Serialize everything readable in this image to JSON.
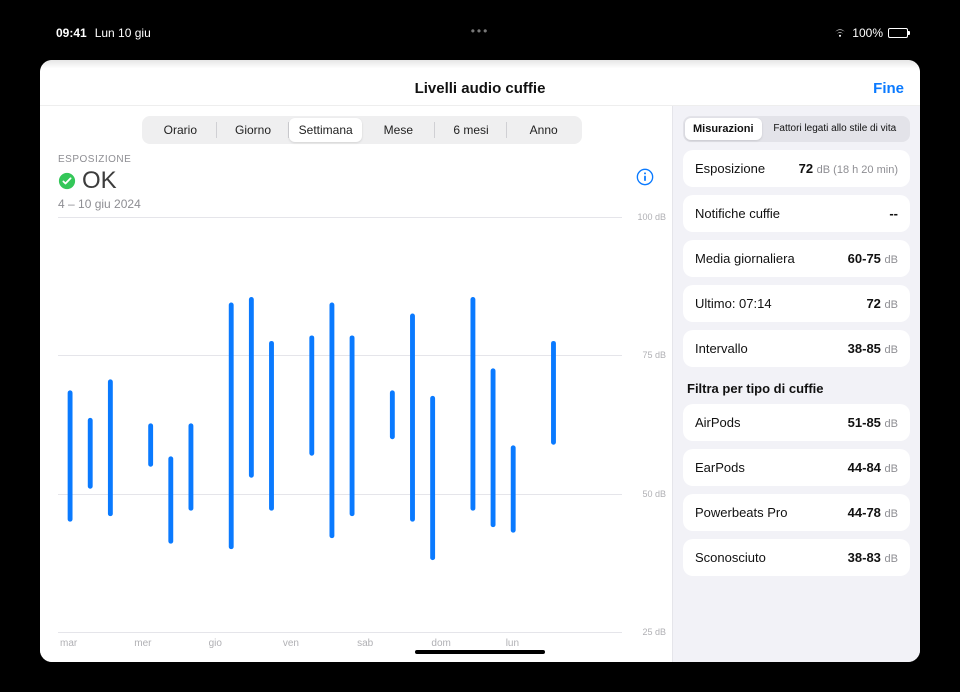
{
  "status_bar": {
    "time": "09:41",
    "date": "Lun 10 giu",
    "battery_pct": "100%"
  },
  "sheet": {
    "title": "Livelli audio cuffie",
    "done": "Fine"
  },
  "segments": [
    "Orario",
    "Giorno",
    "Settimana",
    "Mese",
    "6 mesi",
    "Anno"
  ],
  "segments_active_index": 2,
  "header": {
    "exposure_label": "ESPOSIZIONE",
    "status_text": "OK",
    "date_range": "4 – 10 giu 2024"
  },
  "right_segments": {
    "a": "Misurazioni",
    "b": "Fattori legati allo stile di vita",
    "active": "a"
  },
  "metrics": [
    {
      "k": "Esposizione",
      "val": "72",
      "unit": "dB",
      "note": "(18 h 20 min)"
    },
    {
      "k": "Notifiche cuffie",
      "val": "--",
      "unit": "",
      "note": ""
    },
    {
      "k": "Media giornaliera",
      "val": "60-75",
      "unit": "dB",
      "note": ""
    },
    {
      "k": "Ultimo: 07:14",
      "val": "72",
      "unit": "dB",
      "note": ""
    },
    {
      "k": "Intervallo",
      "val": "38-85",
      "unit": "dB",
      "note": ""
    }
  ],
  "filter_title": "Filtra per tipo di cuffie",
  "filters": [
    {
      "k": "AirPods",
      "val": "51-85",
      "unit": "dB"
    },
    {
      "k": "EarPods",
      "val": "44-84",
      "unit": "dB"
    },
    {
      "k": "Powerbeats Pro",
      "val": "44-78",
      "unit": "dB"
    },
    {
      "k": "Sconosciuto",
      "val": "38-83",
      "unit": "dB"
    }
  ],
  "chart_data": {
    "type": "range-bar",
    "ylabel": "dB",
    "ylim": [
      25,
      100
    ],
    "y_ticks": [
      25,
      50,
      75,
      100
    ],
    "y_tick_labels": [
      "25 dB",
      "50 dB",
      "75 dB",
      "100 dB"
    ],
    "categories": [
      "mar",
      "mer",
      "gio",
      "ven",
      "sab",
      "dom",
      "lun"
    ],
    "series": [
      {
        "day": 0,
        "ranges": [
          [
            45,
            68
          ],
          [
            51,
            63
          ],
          [
            46,
            70
          ]
        ]
      },
      {
        "day": 1,
        "ranges": [
          [
            55,
            62
          ],
          [
            41,
            56
          ],
          [
            47,
            62
          ]
        ]
      },
      {
        "day": 2,
        "ranges": [
          [
            40,
            84
          ],
          [
            53,
            85
          ],
          [
            47,
            77
          ]
        ]
      },
      {
        "day": 3,
        "ranges": [
          [
            57,
            78
          ],
          [
            42,
            84
          ],
          [
            46,
            78
          ]
        ]
      },
      {
        "day": 4,
        "ranges": [
          [
            60,
            68
          ],
          [
            45,
            82
          ],
          [
            38,
            67
          ]
        ]
      },
      {
        "day": 5,
        "ranges": [
          [
            47,
            85
          ],
          [
            44,
            72
          ],
          [
            43,
            58
          ]
        ]
      },
      {
        "day": 6,
        "ranges": [
          [
            59,
            77
          ]
        ]
      }
    ]
  }
}
